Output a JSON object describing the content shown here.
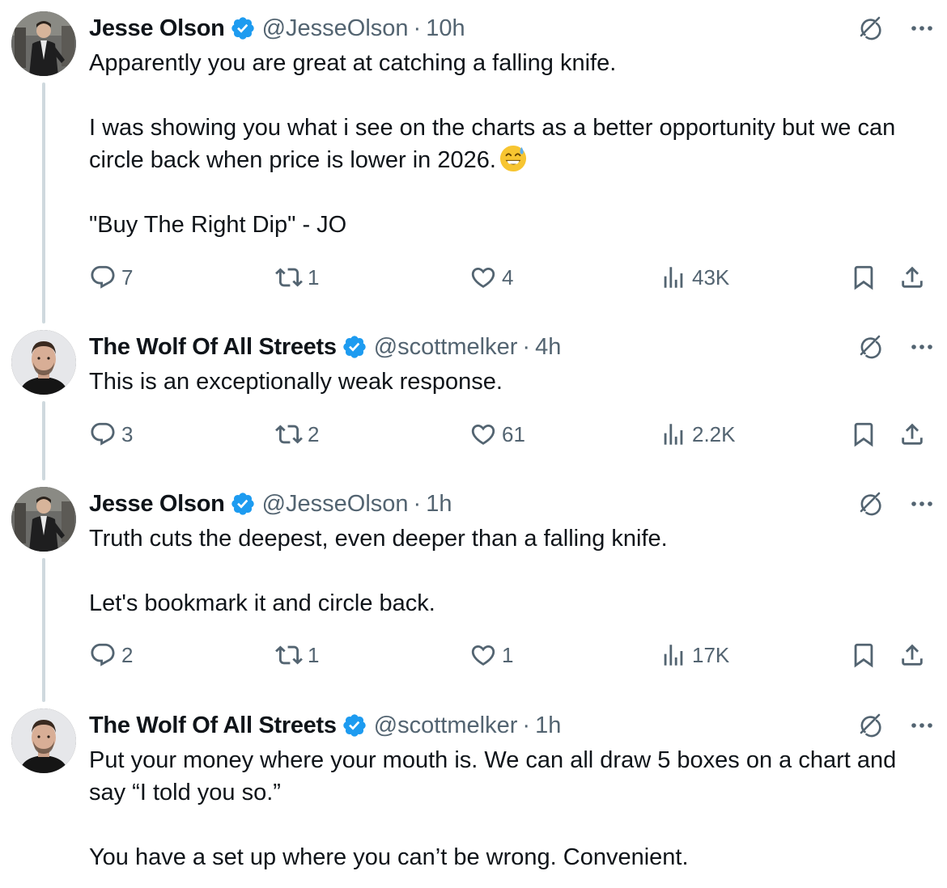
{
  "tweets": [
    {
      "name": "Jesse Olson",
      "handle": "@JesseOlson",
      "separator": "·",
      "time": "10h",
      "body": [
        "Apparently you are great at catching a falling knife.",
        "I was showing you what i see on the charts as a better opportunity but we can circle back when price is lower in 2026.",
        "\"Buy The Right Dip\" - JO"
      ],
      "emoji": "grinning-face-with-sweat",
      "counts": {
        "replies": "7",
        "reposts": "1",
        "likes": "4",
        "views": "43K"
      }
    },
    {
      "name": "The Wolf Of All Streets",
      "handle": "@scottmelker",
      "separator": "·",
      "time": "4h",
      "body": [
        "This is an exceptionally weak response."
      ],
      "counts": {
        "replies": "3",
        "reposts": "2",
        "likes": "61",
        "views": "2.2K"
      }
    },
    {
      "name": "Jesse Olson",
      "handle": "@JesseOlson",
      "separator": "·",
      "time": "1h",
      "body": [
        "Truth cuts the deepest, even deeper than a falling knife.",
        "Let's bookmark it and circle back."
      ],
      "counts": {
        "replies": "2",
        "reposts": "1",
        "likes": "1",
        "views": "17K"
      }
    },
    {
      "name": "The Wolf Of All Streets",
      "handle": "@scottmelker",
      "separator": "·",
      "time": "1h",
      "body": [
        "Put your money where your mouth is. We can all draw 5 boxes on a chart and say “I told you so.”",
        "You have a set up where you can’t be wrong. Convenient."
      ]
    }
  ],
  "colors": {
    "verified": "#1d9bf0",
    "secondary_text": "#536471",
    "thread_line": "#cfd9de",
    "primary_text": "#0f1419"
  },
  "icons": [
    "verified-badge-icon",
    "grok-icon",
    "more-icon",
    "reply-icon",
    "repost-icon",
    "like-icon",
    "views-icon",
    "bookmark-icon",
    "share-icon"
  ]
}
